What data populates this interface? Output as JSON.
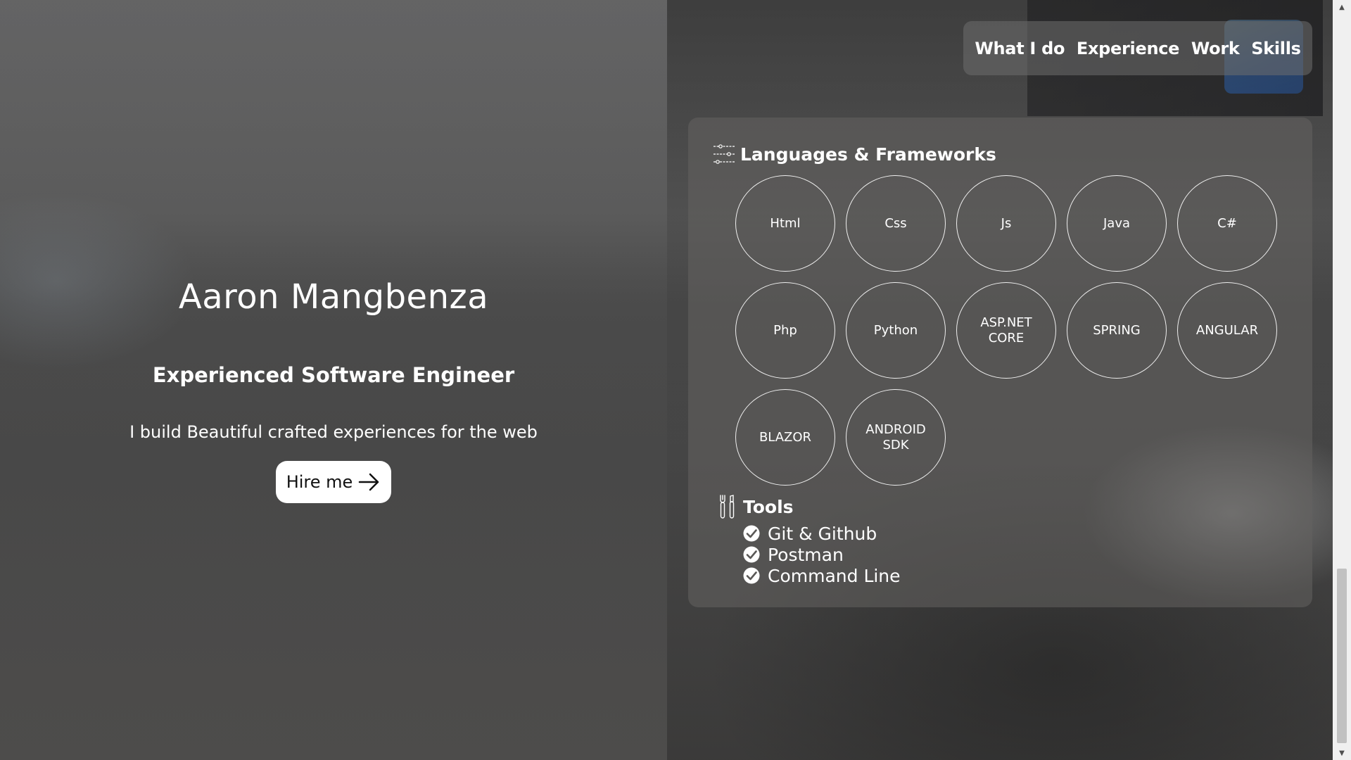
{
  "hero": {
    "name": "Aaron Mangbenza",
    "role": "Experienced Software Engineer",
    "tagline": "I build Beautiful crafted experiences for the web",
    "hire_label": "Hire me",
    "hire_icon": "arrow-right-icon"
  },
  "nav": {
    "links": [
      {
        "label": "What I do"
      },
      {
        "label": "Experience"
      },
      {
        "label": "Work"
      },
      {
        "label": "Skills"
      }
    ]
  },
  "skills": {
    "languages_title": "Languages & Frameworks",
    "languages_icon": "sliders-icon",
    "languages": [
      "Html",
      "Css",
      "Js",
      "Java",
      "C#",
      "Php",
      "Python",
      "ASP.NET CORE",
      "SPRING",
      "ANGULAR",
      "BLAZOR",
      "ANDROID SDK"
    ],
    "tools_title": "Tools",
    "tools_icon": "tools-icon",
    "tools": [
      {
        "label": "Git & Github",
        "icon": "check-circle-icon"
      },
      {
        "label": "Postman",
        "icon": "check-circle-icon"
      },
      {
        "label": "Command Line",
        "icon": "check-circle-icon"
      }
    ]
  },
  "scrollbar": {
    "up_icon": "scroll-up-arrow-icon",
    "down_icon": "scroll-down-arrow-icon"
  }
}
